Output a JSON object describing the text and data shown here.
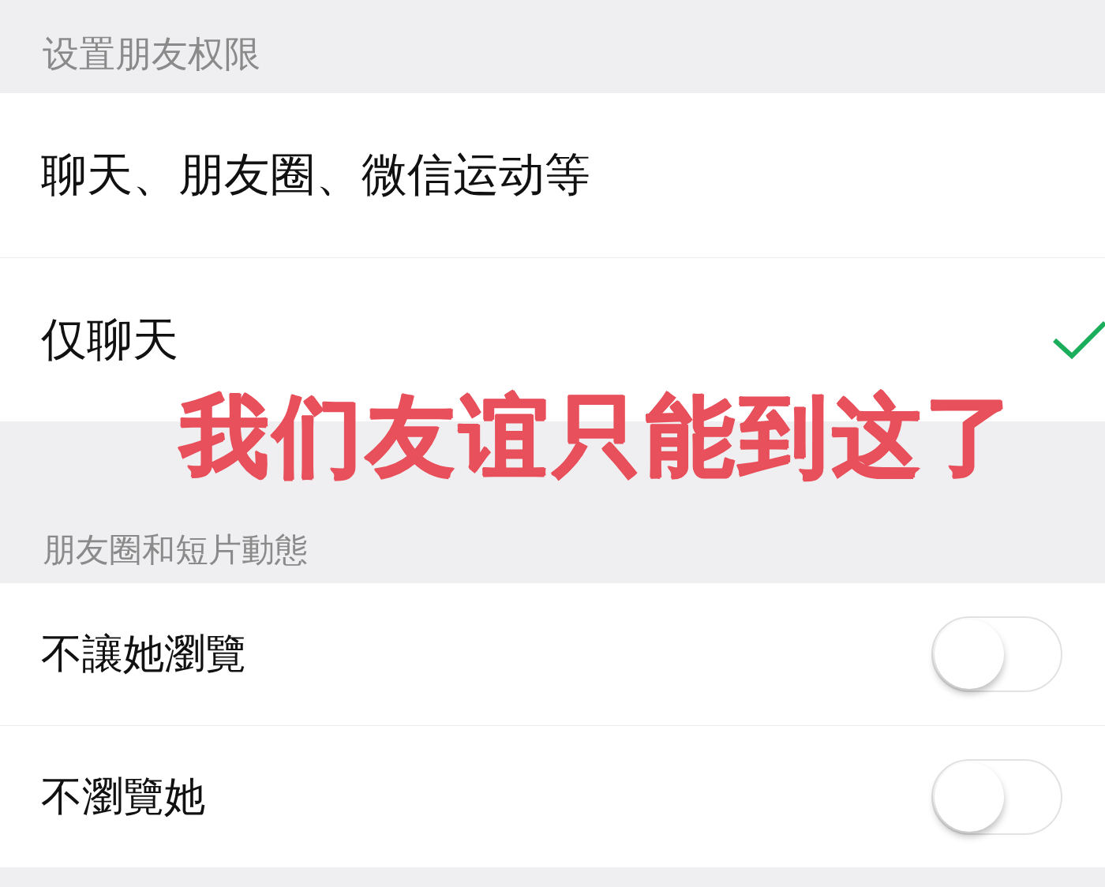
{
  "sections": [
    {
      "header": "设置朋友权限",
      "rows": [
        {
          "kind": "check",
          "label": "聊天、朋友圈、微信运动等",
          "selected": false
        },
        {
          "kind": "check",
          "label": "仅聊天",
          "selected": true
        }
      ]
    },
    {
      "header": "朋友圈和短片動態",
      "rows": [
        {
          "kind": "toggle",
          "label": "不讓她瀏覽",
          "on": false
        },
        {
          "kind": "toggle",
          "label": "不瀏覽她",
          "on": false
        }
      ]
    }
  ],
  "caption": "我们友谊只能到这了"
}
